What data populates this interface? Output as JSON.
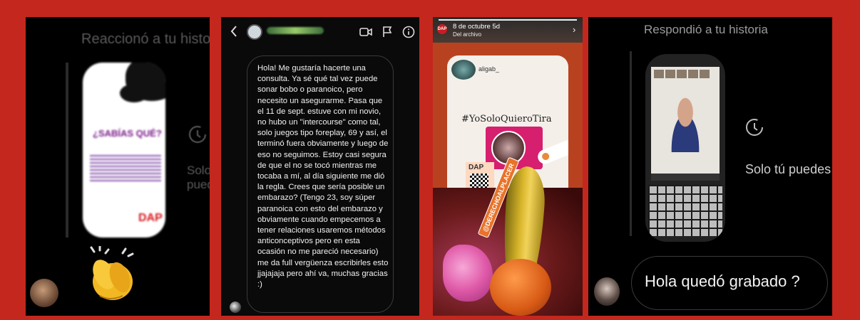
{
  "panel1": {
    "header": "Reaccionó a tu historia",
    "card_title": "¿SABÍAS QUÉ?",
    "card_logo": "DAP",
    "side_text": "Solo tú puedes",
    "reaction_icon": "clapping-hands-icon"
  },
  "panel2": {
    "back_icon": "chevron-left-icon",
    "icons": [
      "video-call-icon",
      "flag-icon",
      "info-icon"
    ],
    "message": "Hola! Me gustaría hacerte una consulta. Ya sé qué tal vez puede sonar bobo o paranoico, pero necesito un asegurarme. Pasa que el 11 de sept. estuve con mi novio, no hubo un \"intercourse\" como tal, solo juegos tipo foreplay, 69 y así, el terminó fuera obviamente y luego de eso no seguimos. Estoy casi segura de que el no se tocó mientras me tocaba a mí, al día siguiente me dió la regla. Crees que sería posible un embarazo? (Tengo 23, soy súper paranoica con esto del embarazo y obviamente cuando empecemos a tener relaciones usaremos métodos anticonceptivos pero en esta ocasión no me pareció necesario) me da full vergüenza escribirles esto jjajajaja pero ahí va, muchas gracias :)"
  },
  "panel3": {
    "logo": "DAP",
    "date": "8 de octubre",
    "age": "5d",
    "subtitle": "Del archivo",
    "close_icon": "chevron-right-icon",
    "handle": "aligab_",
    "hashtag": "#YoSoloQuieroTira",
    "card_logo": "DAP",
    "sticker_label": "@DERECHOALPLACER"
  },
  "panel4": {
    "header": "Respondió a tu historia",
    "side_text": "Solo tú puedes",
    "reply": "Hola quedó grabado ?"
  }
}
